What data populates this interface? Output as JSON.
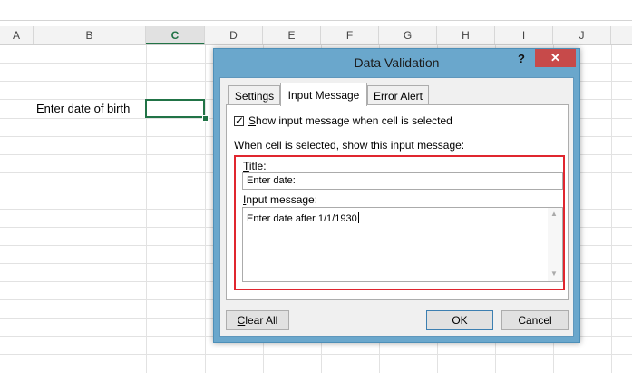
{
  "sheet": {
    "columns": [
      "A",
      "B",
      "C",
      "D",
      "E",
      "F",
      "G",
      "H",
      "I",
      "J"
    ],
    "selected_column": "C",
    "cell_text": "Enter date of birth",
    "accent": "#217346"
  },
  "dialog": {
    "title": "Data Validation",
    "help_glyph": "?",
    "close_glyph": "✕",
    "tabs": [
      {
        "label": "Settings",
        "active": false
      },
      {
        "label": "Input Message",
        "active": true
      },
      {
        "label": "Error Alert",
        "active": false
      }
    ],
    "show_message_checkbox": {
      "checked": true,
      "label_underlined": "S",
      "label_rest": "how input message when cell is selected"
    },
    "subheading": "When cell is selected, show this input message:",
    "title_label_underlined": "T",
    "title_label_rest": "itle:",
    "title_value": "Enter date:",
    "message_label_underlined": "I",
    "message_label_rest": "nput message:",
    "message_value": "Enter date after 1/1/1930",
    "buttons": {
      "clear_underlined": "C",
      "clear_rest": "lear All",
      "ok": "OK",
      "cancel": "Cancel"
    },
    "highlight_color": "#e0262f"
  }
}
